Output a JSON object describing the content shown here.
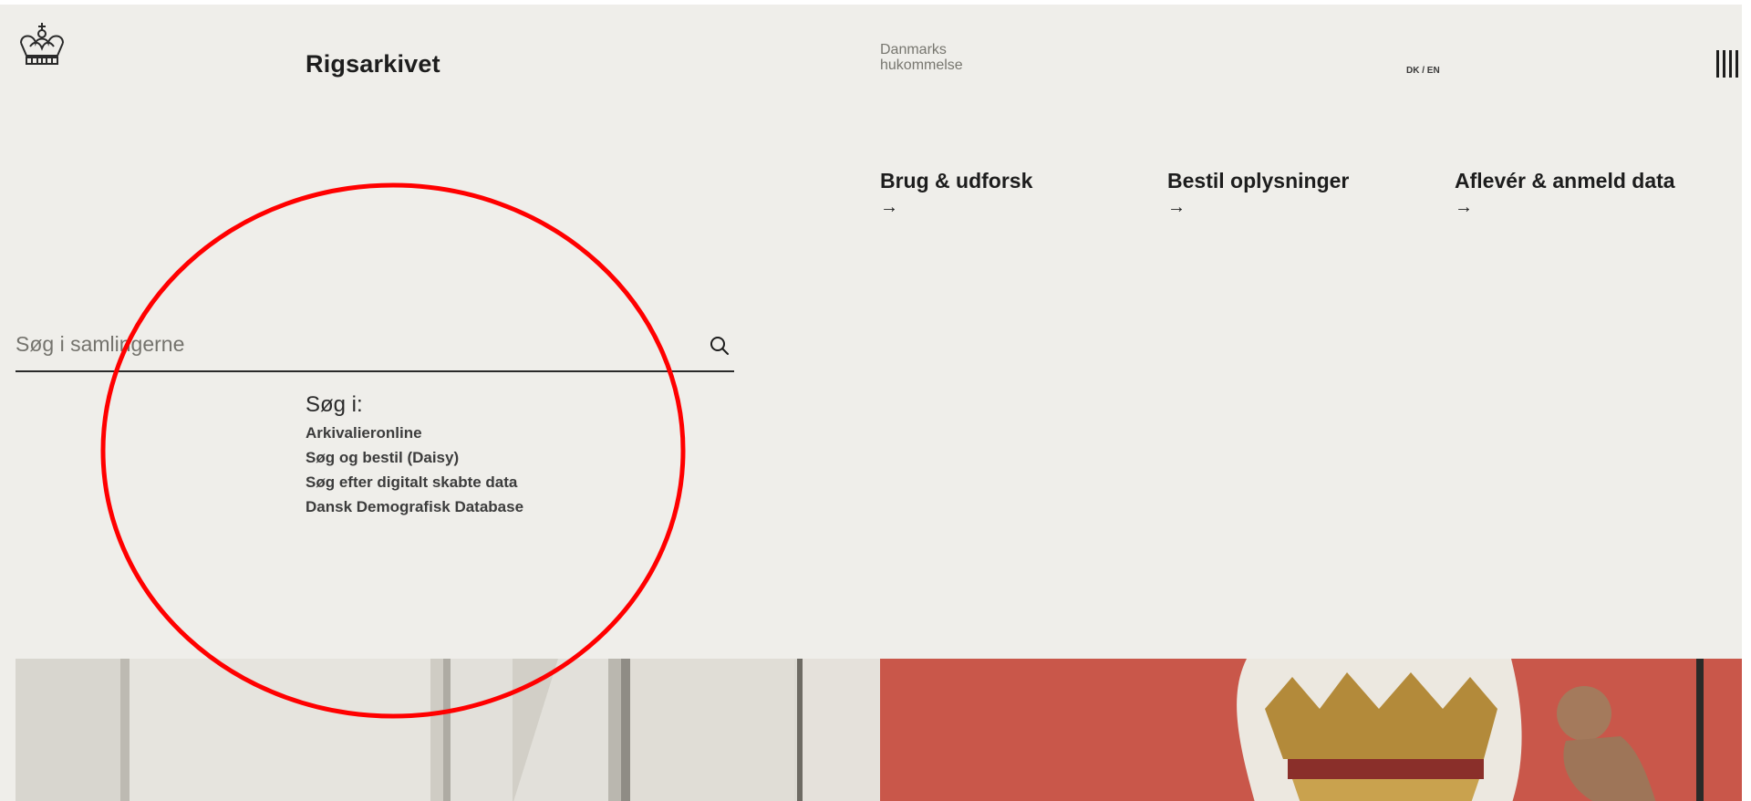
{
  "header": {
    "logo_icon": "royal-crown-icon",
    "brand": "Rigsarkivet",
    "tagline": [
      "Danmarks",
      "hukommelse"
    ],
    "language_switch": "DK / EN",
    "menu_icon": "menu-bars-icon"
  },
  "nav": [
    {
      "label": "Brug & udforsk",
      "arrow": "→"
    },
    {
      "label": "Bestil oplysninger",
      "arrow": "→"
    },
    {
      "label": "Aflevér & anmeld data",
      "arrow": "→"
    }
  ],
  "search": {
    "placeholder": "Søg i samlingerne",
    "value": "",
    "icon": "search-icon"
  },
  "search_in": {
    "title": "Søg i:",
    "links": [
      "Arkivalieronline",
      "Søg og bestil (Daisy)",
      "Søg efter digitalt skabte data",
      "Dansk Demografisk Database"
    ]
  },
  "colors": {
    "background": "#efeeea",
    "text": "#1d1d1d",
    "muted": "#77766f",
    "annotation": "#ff0000"
  }
}
